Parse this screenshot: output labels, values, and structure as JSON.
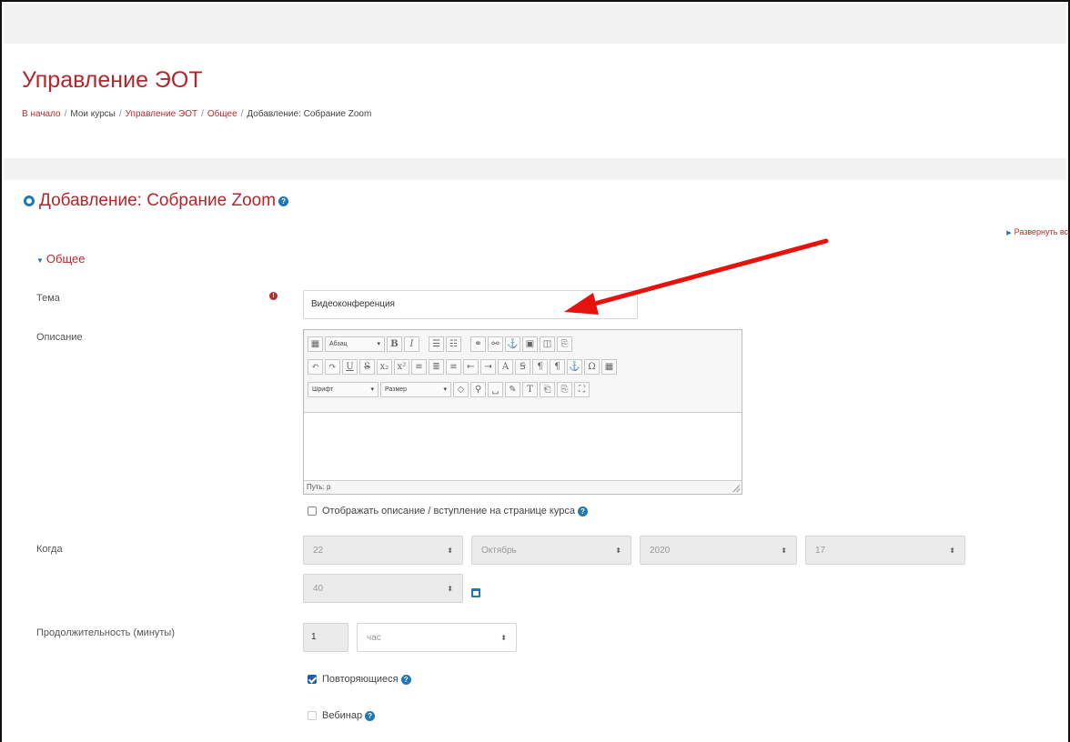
{
  "header": {
    "course_title": "Управление ЭОТ",
    "breadcrumb": [
      "В начало",
      "Мои курсы",
      "Управление ЭОТ",
      "Общее",
      "Добавление: Собрание Zoom"
    ]
  },
  "page": {
    "title": "Добавление: Собрание Zoom",
    "expand_all": "Развернуть вс"
  },
  "section": {
    "label": "Общее"
  },
  "form": {
    "topic_label": "Тема",
    "topic_value": "Видеоконференция",
    "description_label": "Описание",
    "editor": {
      "paragraph_select": "Абзац",
      "font_select": "Шрифт",
      "size_select": "Размер",
      "path": "Путь: p"
    },
    "show_description_label": "Отображать описание / вступление на странице курса",
    "when_label": "Когда",
    "when": {
      "day": "22",
      "month": "Октябрь",
      "year": "2020",
      "hour": "17",
      "minute": "40"
    },
    "duration_label": "Продолжительность (минуты)",
    "duration": {
      "value": "1",
      "unit": "час"
    },
    "recurring_label": "Повторяющиеся",
    "webinar_label": "Вебинар"
  },
  "colors": {
    "accent": "#b3262b",
    "link": "#c0282e",
    "help": "#1f77b4",
    "annotation_arrow": "#e8120c"
  }
}
